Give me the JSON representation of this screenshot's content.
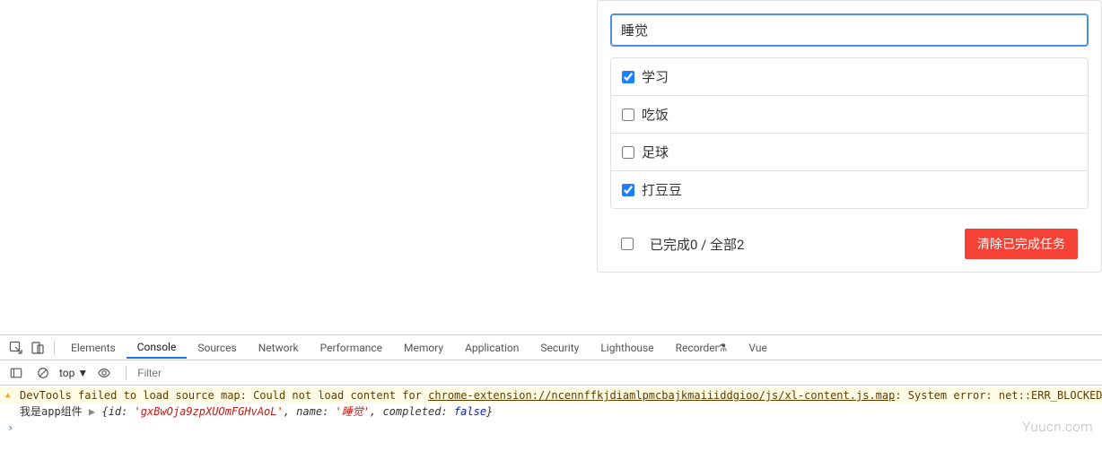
{
  "app": {
    "input_value": "睡觉",
    "todos": [
      {
        "label": "学习",
        "checked": true
      },
      {
        "label": "吃饭",
        "checked": false
      },
      {
        "label": "足球",
        "checked": false
      },
      {
        "label": "打豆豆",
        "checked": true
      }
    ],
    "footer_text": "已完成0 / 全部2",
    "clear_button": "清除已完成任务"
  },
  "devtools": {
    "tabs": {
      "elements": "Elements",
      "console": "Console",
      "sources": "Sources",
      "network": "Network",
      "performance": "Performance",
      "memory": "Memory",
      "application": "Application",
      "security": "Security",
      "lighthouse": "Lighthouse",
      "recorder": "Recorder",
      "vue": "Vue"
    },
    "toolbar": {
      "top_label": "top",
      "filter_placeholder": "Filter"
    },
    "console": {
      "warn_prefix": "DevTools failed to load source map: Could not load content for ",
      "warn_url": "chrome-extension://ncennffkjdiamlpmcbajkmaiiiddgioo/js/xl-content.js.map",
      "warn_suffix": ": System error: net::ERR_BLOCKED_BY_CLIENT",
      "log_prefix": "我是app组件",
      "obj_id_key": "id:",
      "obj_id_val": "'gxBwOja9zpXUOmFGHvAoL'",
      "obj_name_key": "name:",
      "obj_name_val": "'睡觉'",
      "obj_completed_key": "completed:",
      "obj_completed_val": "false"
    }
  },
  "watermark": "Yuucn.com"
}
